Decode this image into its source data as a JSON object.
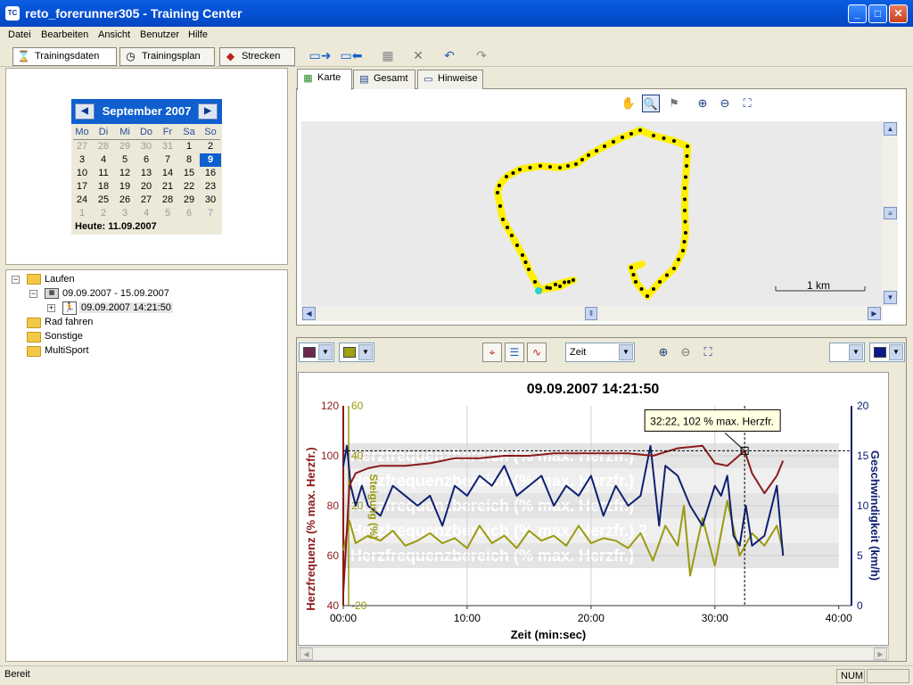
{
  "window": {
    "title": "reto_forerunner305 - Training Center",
    "icon_text": "TC",
    "minimize": "_",
    "maximize": "□",
    "close": "✕"
  },
  "menu": [
    "Datei",
    "Bearbeiten",
    "Ansicht",
    "Benutzer",
    "Hilfe"
  ],
  "toolbar": {
    "trainingsdaten": "Trainingsdaten",
    "trainingsplan": "Trainingsplan",
    "strecken": "Strecken"
  },
  "calendar": {
    "month": "September 2007",
    "weekdays": [
      "Mo",
      "Di",
      "Mi",
      "Do",
      "Fr",
      "Sa",
      "So"
    ],
    "weeks": [
      [
        "27",
        "28",
        "29",
        "30",
        "31",
        "1",
        "2"
      ],
      [
        "3",
        "4",
        "5",
        "6",
        "7",
        "8",
        "9"
      ],
      [
        "10",
        "11",
        "12",
        "13",
        "14",
        "15",
        "16"
      ],
      [
        "17",
        "18",
        "19",
        "20",
        "21",
        "22",
        "23"
      ],
      [
        "24",
        "25",
        "26",
        "27",
        "28",
        "29",
        "30"
      ],
      [
        "1",
        "2",
        "3",
        "4",
        "5",
        "6",
        "7"
      ]
    ],
    "selected": "9",
    "today": "Heute: 11.09.2007"
  },
  "tree": {
    "laufen": "Laufen",
    "week": "09.09.2007 - 15.09.2007",
    "activity": "09.09.2007 14:21:50",
    "rad": "Rad fahren",
    "sonstige": "Sonstige",
    "multisport": "MultiSport"
  },
  "tabs": [
    "Karte",
    "Gesamt",
    "Hinweise"
  ],
  "map": {
    "scale_label": "1 km"
  },
  "chart_controls": {
    "x_axis_select": "Zeit"
  },
  "chart_data": {
    "type": "line",
    "title": "09.09.2007 14:21:50",
    "xlabel": "Zeit (min:sec)",
    "x_ticks": [
      "00:00",
      "10:00",
      "20:00",
      "30:00",
      "40:00"
    ],
    "xlim": [
      0,
      40
    ],
    "y_axes": [
      {
        "label": "Herzfrequenz (% max. Herzfr.)",
        "ticks": [
          "40",
          "60",
          "80",
          "100",
          "120"
        ],
        "range": [
          40,
          120
        ],
        "color": "#8b1a1a"
      },
      {
        "label": "Steigung (%)",
        "ticks": [
          "-20",
          "20",
          "40",
          "60"
        ],
        "range": [
          -20,
          60
        ],
        "color": "#9a9a10"
      },
      {
        "label": "Geschwindigkeit (km/h)",
        "ticks": [
          "0",
          "5",
          "10",
          "15",
          "20"
        ],
        "range": [
          0,
          20
        ],
        "color": "#102070"
      }
    ],
    "zones": [
      "Herzfrequenzbereich (% max. Herzfr.)",
      "Herzfrequenzbereich (% max. Herzfr.)",
      "Herzfrequenzbereich (% max. Herzfr.)",
      "Herzfrequenzbereich (% max. Herzfr.) 2",
      "Herzfrequenzbereich (% max. Herzfr.)"
    ],
    "tooltip": "32:22, 102 % max. Herzfr.",
    "series": [
      {
        "name": "Herzfrequenz",
        "color": "#8b1a1a",
        "x": [
          0,
          0.5,
          1,
          2,
          3,
          5,
          7,
          9,
          11,
          13,
          15,
          17,
          19,
          21,
          23,
          25,
          27,
          29,
          30,
          31,
          32.4,
          33,
          34,
          35,
          35.5
        ],
        "y": [
          45,
          88,
          93,
          95,
          96,
          96,
          97,
          99,
          99,
          100,
          100,
          101,
          101,
          101,
          101,
          100,
          103,
          104,
          97,
          96,
          102,
          93,
          85,
          92,
          98
        ]
      },
      {
        "name": "Geschwindigkeit",
        "color": "#102070",
        "x": [
          0,
          0.3,
          0.6,
          1,
          1.5,
          2,
          3,
          4,
          5,
          6,
          7,
          8,
          9,
          10,
          11,
          12,
          13,
          14,
          15,
          16,
          17,
          18,
          19,
          20,
          21,
          22,
          23,
          24,
          24.8,
          25.5,
          26,
          27,
          28,
          29,
          30,
          30.5,
          31,
          31.5,
          32,
          32.5,
          33,
          34,
          35,
          35.5
        ],
        "y": [
          14,
          16,
          12,
          10,
          12,
          10,
          9,
          12,
          11,
          10,
          11,
          8,
          12,
          11,
          13,
          12,
          14,
          11,
          12,
          13,
          10,
          12,
          11,
          13,
          9,
          12,
          10,
          11,
          16,
          8,
          14,
          13,
          10,
          8,
          12,
          11,
          13,
          7,
          6,
          10,
          6,
          7,
          12,
          5
        ]
      },
      {
        "name": "Steigung",
        "color": "#9a9a10",
        "x": [
          0,
          0.5,
          1,
          2,
          3,
          4,
          5,
          6,
          7,
          8,
          9,
          10,
          11,
          12,
          13,
          14,
          15,
          16,
          17,
          18,
          19,
          20,
          21,
          22,
          23,
          24,
          25,
          26,
          27,
          27.5,
          28,
          29,
          30,
          31,
          32,
          33,
          34,
          35,
          35.5
        ],
        "y": [
          2,
          14,
          5,
          8,
          6,
          10,
          4,
          6,
          9,
          5,
          7,
          3,
          12,
          5,
          8,
          3,
          10,
          6,
          8,
          4,
          12,
          5,
          7,
          6,
          3,
          9,
          -2,
          12,
          4,
          20,
          -8,
          15,
          -4,
          22,
          0,
          9,
          4,
          12,
          2
        ]
      }
    ],
    "cursor_x": 32.4
  },
  "status": {
    "text": "Bereit",
    "num": "NUM"
  }
}
